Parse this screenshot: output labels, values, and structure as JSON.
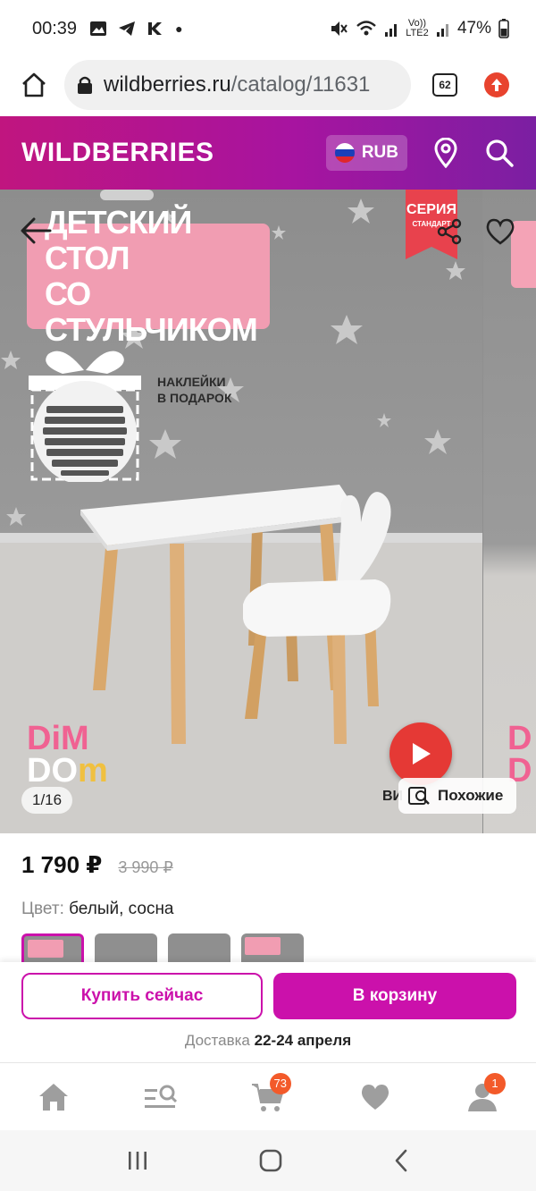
{
  "status_bar": {
    "time": "00:39",
    "network": "Vo)) LTE2",
    "battery": "47%"
  },
  "browser": {
    "url_host": "wildberries.ru",
    "url_path": "/catalog/11631",
    "tabs_count": "62"
  },
  "header": {
    "logo": "WILDBERRIES",
    "currency": "RUB"
  },
  "gallery": {
    "promo_line1": "ДЕТСКИЙ СТОЛ",
    "promo_line2": "СО СТУЛЬЧИКОМ",
    "seria_label": "СЕРИЯ",
    "seria_sub": "СТАНДАРТ",
    "sticker_line1": "НАКЛЕЙКИ",
    "sticker_line2": "В ПОДАРОК",
    "brand_line1": "DiM",
    "brand_line2a": "DO",
    "brand_line2b": "m",
    "counter": "1/16",
    "video_label": "ВИ",
    "similar_label": "Похожие"
  },
  "product": {
    "price": "1 790 ₽",
    "old_price": "3 990 ₽",
    "color_label": "Цвет:",
    "color_value": "белый, сосна"
  },
  "actions": {
    "buy_now": "Купить сейчас",
    "to_cart": "В корзину",
    "delivery_label": "Доставка",
    "delivery_dates": "22-24 апреля"
  },
  "bottom_nav": {
    "cart_badge": "73",
    "profile_badge": "1"
  },
  "colors": {
    "brand_purple": "#cb11ab",
    "header_gradient_start": "#c0157f",
    "header_gradient_end": "#7b1fa2",
    "badge": "#f35a2a"
  }
}
